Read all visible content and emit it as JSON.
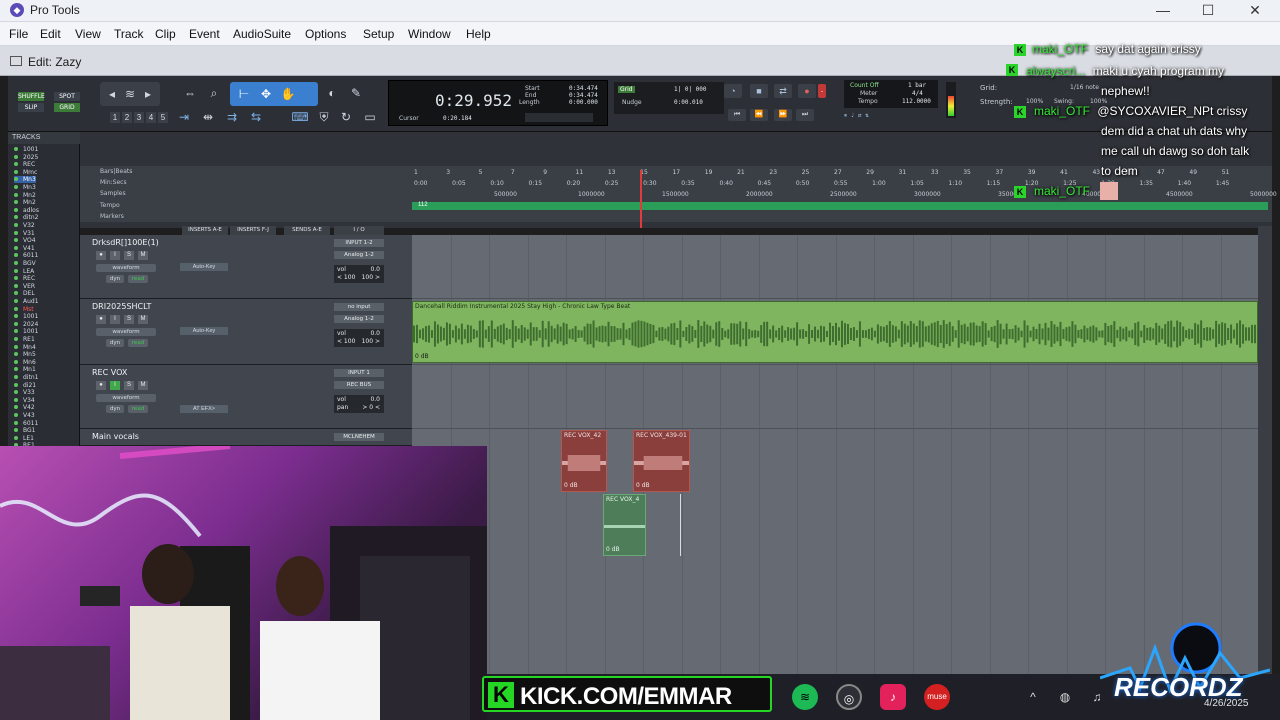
{
  "window": {
    "app_title": "Pro Tools",
    "minimize": "—",
    "maximize": "☐",
    "close": "✕"
  },
  "menu": [
    "File",
    "Edit",
    "View",
    "Track",
    "Clip",
    "Event",
    "AudioSuite",
    "Options",
    "Setup",
    "Window",
    "Help"
  ],
  "edit_window": {
    "title": "Edit: Zazy"
  },
  "toolbar": {
    "modes": [
      "SHUFFLE",
      "SPOT",
      "SLIP",
      "GRID"
    ],
    "zoom_presets": [
      "1",
      "2",
      "3",
      "4",
      "5"
    ],
    "main_counter": "0:29.952",
    "start_label": "Start",
    "end_label": "End",
    "length_label": "Length",
    "start": "0:34.474",
    "end": "0:34.474",
    "length": "0:00.000",
    "cursor_label": "Cursor",
    "cursor": "0:20.184",
    "grid_label": "Grid",
    "grid_value": "1| 0| 000",
    "nudge_label": "Nudge",
    "nudge_value": "0:00.010",
    "count_off": "Count Off",
    "meter_label": "Meter",
    "tempo_label": "Tempo",
    "bar_count": "1 bar",
    "meter": "4/4",
    "tempo": "112.0000",
    "grid_right_label": "Grid:",
    "grid_right_value": "1/16 note",
    "strength_label": "Strength:",
    "strength_value": "100%",
    "swing_label": "Swing:",
    "swing_value": "100%"
  },
  "tracks_list": {
    "header": "TRACKS",
    "items": [
      "1001",
      "2025",
      "REC",
      "Mmc",
      "Mn3",
      "Mn3",
      "Mn2",
      "Mn2",
      "adlos",
      "ditn2",
      "V32",
      "V31",
      "VO4",
      "V41",
      "6011",
      "BGV",
      "LEA",
      "REC",
      "VER",
      "DEL",
      "Aud1",
      "Mst",
      "1001",
      "2024",
      "1001",
      "RE1",
      "Mn4",
      "Mn5",
      "Mn6",
      "Mn1",
      "ditn1",
      "di21",
      "V33",
      "V34",
      "V42",
      "V43",
      "6011",
      "BG1",
      "LE1",
      "RE1"
    ],
    "selected_index": 4
  },
  "rulers": {
    "names": [
      "Bars|Beats",
      "Min:Secs",
      "Samples",
      "Tempo",
      "Markers"
    ],
    "bars": [
      "1",
      "3",
      "5",
      "7",
      "9",
      "11",
      "13",
      "15",
      "17",
      "19",
      "21",
      "23",
      "25",
      "27",
      "29",
      "31",
      "33",
      "35",
      "37",
      "39",
      "41",
      "43",
      "45",
      "47",
      "49",
      "51"
    ],
    "secs": [
      "0:00",
      "0:05",
      "0:10",
      "0:15",
      "0:20",
      "0:25",
      "0:30",
      "0:35",
      "0:40",
      "0:45",
      "0:50",
      "0:55",
      "1:00",
      "1:05",
      "1:10",
      "1:15",
      "1:20",
      "1:25",
      "1:30",
      "1:35",
      "1:40",
      "1:45"
    ],
    "samples": [
      "500000",
      "1000000",
      "1500000",
      "2000000",
      "2500000",
      "3000000",
      "3500000",
      "4000000",
      "4500000",
      "5000000"
    ],
    "tempo_marker": "112"
  },
  "columns": {
    "inserts_ae": "INSERTS A-E",
    "inserts_fj": "INSERTS F-J",
    "sends_ae": "SENDS A-E",
    "io": "I / O"
  },
  "strips": [
    {
      "name": "DrksdR[]100E(1)",
      "view": "waveform",
      "dyn": "dyn",
      "read": "read",
      "insert": "Auto-Key",
      "input": "INPUT 1-2",
      "output": "Analog 1-2",
      "vol": "0.0",
      "pan_l": "< 100",
      "pan_r": "100 >"
    },
    {
      "name": "DRI2025SHCLT",
      "view": "waveform",
      "dyn": "dyn",
      "read": "read",
      "insert": "Auto-Key",
      "input": "no input",
      "output": "Analog 1-2",
      "vol": "0.0",
      "pan_l": "< 100",
      "pan_r": "100 >"
    },
    {
      "name": "REC VOX",
      "view": "waveform",
      "dyn": "dyn",
      "read": "read",
      "insert": "AT EFX>",
      "input": "INPUT 1",
      "output": "REC BUS",
      "vol": "0.0",
      "pan_l": "pan",
      "pan_r": "> 0 <"
    },
    {
      "name": "Main vocals",
      "view": "",
      "dyn": "",
      "read": "",
      "insert": "",
      "input": "MCLNEHEM",
      "output": "",
      "vol": "",
      "pan_l": "",
      "pan_r": ""
    }
  ],
  "clips": {
    "beat": {
      "label": "Dancehall Riddim Instrumental 2025 Stay High - Chronic Law Type Beat",
      "gain": "0 dB"
    },
    "vox1": {
      "label": "REC VOX_42",
      "gain": "0 dB"
    },
    "vox2": {
      "label": "REC VOX_439-01",
      "gain": "0 dB"
    },
    "vox3": {
      "label": "REC VOX_4",
      "gain": "0 dB"
    }
  },
  "chat": [
    {
      "user": "maki_OTF",
      "message": "say dat again crissy"
    },
    {
      "user": "alwayscri...",
      "message": "maki u cyah program my"
    },
    {
      "user": "",
      "message": "nephew!!"
    },
    {
      "user": "maki_OTF",
      "message": "@SYCOXAVIER_NPt crissy"
    },
    {
      "user": "",
      "message": "dem did a chat uh dats why"
    },
    {
      "user": "",
      "message": "me call uh dawg so doh talk"
    },
    {
      "user": "",
      "message": "to dem"
    },
    {
      "user": "maki_OTF",
      "message": ""
    }
  ],
  "overlay": {
    "kick_url": "KICK.COM/EMMAR",
    "logo_text": "RECORDZ",
    "date": "4/26/2025"
  },
  "colors": {
    "accent_green": "#25d625",
    "clip_green": "#7fb55f",
    "clip_red": "#8a3f3d",
    "selection_blue": "#3561a6"
  }
}
